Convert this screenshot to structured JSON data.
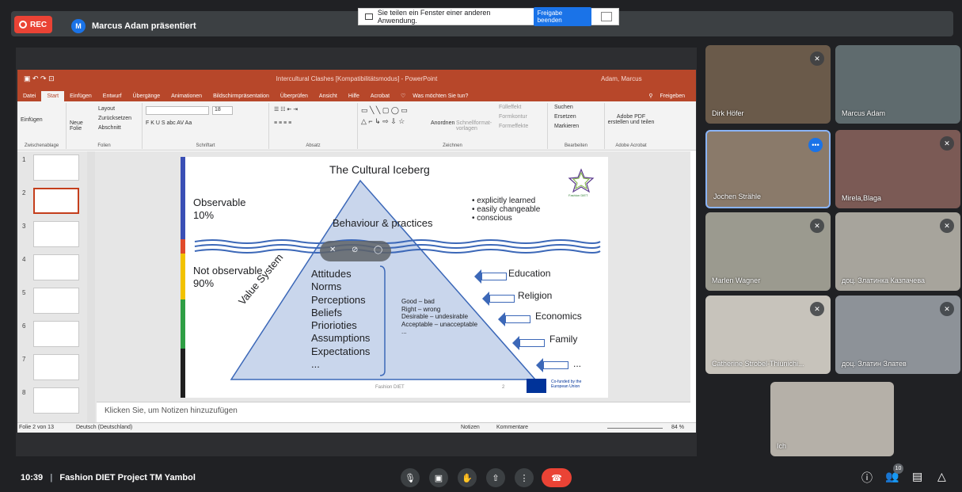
{
  "topbar": {
    "rec_label": "REC",
    "presenter_initial": "M",
    "presenter_text": "Marcus Adam präsentiert"
  },
  "share_bar": {
    "text": "Sie teilen ein Fenster einer anderen Anwendung.",
    "button": "Freigabe beenden"
  },
  "powerpoint": {
    "title": "Intercultural Clashes [Kompatibilitätsmodus] - PowerPoint",
    "user": "Adam, Marcus",
    "tabs": [
      "Datei",
      "Start",
      "Einfügen",
      "Entwurf",
      "Übergänge",
      "Animationen",
      "Bildschirmpräsentation",
      "Überprüfen",
      "Ansicht",
      "Hilfe",
      "Acrobat"
    ],
    "tell_me": "Was möchten Sie tun?",
    "share": "Freigeben",
    "ribbon": {
      "einfuegen": "Einfügen",
      "neue_folie": "Neue Folie",
      "layout": "Layout",
      "zuruecksetzen": "Zurücksetzen",
      "abschnitt": "Abschnitt",
      "font_size": "18",
      "fmt_buttons": "F K U S abc AV Aa",
      "anordnen": "Anordnen",
      "schnellformat": "Schnellformat-vorlagen",
      "fuelleffekt": "Fülleffekt",
      "formkontur": "Formkontur",
      "formeffekte": "Formeffekte",
      "suchen": "Suchen",
      "ersetzen": "Ersetzen",
      "markieren": "Markieren",
      "adobe": "Adobe PDF erstellen und teilen",
      "groups": [
        "Zwischenablage",
        "Folien",
        "Schriftart",
        "Absatz",
        "Zeichnen",
        "Bearbeiten",
        "Adobe Acrobat"
      ]
    },
    "thumb_numbers": [
      "1",
      "2",
      "3",
      "4",
      "5",
      "6",
      "7",
      "8"
    ],
    "notes": "Klicken Sie, um Notizen hinzuzufügen",
    "status": {
      "slide": "Folie 2 von 13",
      "language": "Deutsch (Deutschland)",
      "notizen": "Notizen",
      "kommentare": "Kommentare",
      "zoom": "84 %"
    }
  },
  "slide": {
    "title": "The Cultural Iceberg",
    "observable": "Observable",
    "observable_pct": "10%",
    "behaviour": "Behaviour & practices",
    "bullets": [
      "explicitly learned",
      "easily changeable",
      "conscious"
    ],
    "not_observable": "Not observable",
    "not_observable_pct": "90%",
    "value_system": "Value System",
    "values": [
      "Attitudes",
      "Norms",
      "Perceptions",
      "Beliefs",
      "Priorioties",
      "Assumptions",
      "Expectations",
      "..."
    ],
    "pairs": [
      "Good – bad",
      "Right – wrong",
      "Desirable – undesirable",
      "Acceptable – unacceptable",
      "..."
    ],
    "influences": [
      "Education",
      "Religion",
      "Economics",
      "Family",
      "..."
    ],
    "footer": "Fashion DIET",
    "page": "2",
    "logo_text": "Fashion DIET",
    "eu_text": "Co-funded by the European Union"
  },
  "participants": [
    {
      "name": "Dirk Höfer",
      "muted": true
    },
    {
      "name": "Marcus Adam",
      "muted": false
    },
    {
      "name": "Jochen Strähle",
      "muted": false
    },
    {
      "name": "Mirela,Blaga",
      "muted": true
    },
    {
      "name": "Marlen Wagner",
      "muted": true
    },
    {
      "name": "доц. Златинка Казпачева",
      "muted": true
    },
    {
      "name": "Catherine Strobel-Thiunichi...",
      "muted": true
    },
    {
      "name": "доц. Златин Златев",
      "muted": true
    },
    {
      "name": "Ich",
      "muted": false
    }
  ],
  "bottom": {
    "time": "10:39",
    "separator": "|",
    "meeting": "Fashion DIET Project TM Yambol",
    "people_count": "10"
  }
}
